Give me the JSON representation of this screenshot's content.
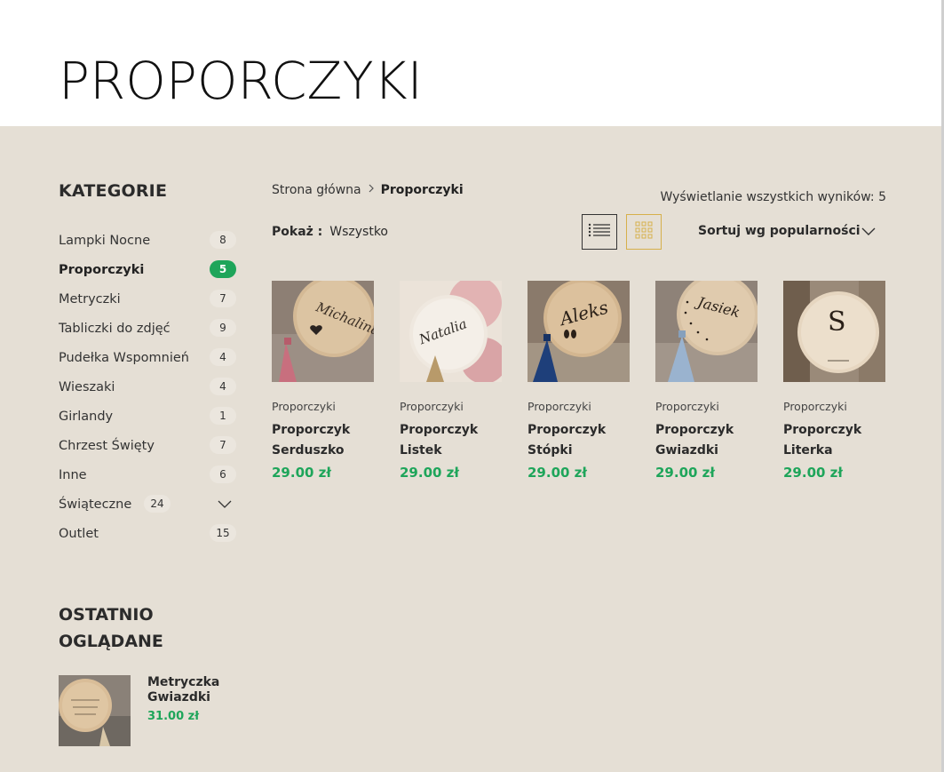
{
  "page": {
    "title": "PROPORCZYKI"
  },
  "sidebar": {
    "categories_title": "KATEGORIE",
    "categories": [
      {
        "label": "Lampki Nocne",
        "count": "8"
      },
      {
        "label": "Proporczyki",
        "count": "5",
        "active": true
      },
      {
        "label": "Metryczki",
        "count": "7"
      },
      {
        "label": "Tabliczki do zdjęć",
        "count": "9"
      },
      {
        "label": "Pudełka Wspomnień",
        "count": "4"
      },
      {
        "label": "Wieszaki",
        "count": "4"
      },
      {
        "label": "Girlandy",
        "count": "1"
      },
      {
        "label": "Chrzest Święty",
        "count": "7"
      },
      {
        "label": "Inne",
        "count": "6"
      },
      {
        "label": "Świąteczne",
        "count": "24",
        "expandable": true
      },
      {
        "label": "Outlet",
        "count": "15"
      }
    ],
    "recent_title": "OSTATNIO OGLĄDANE",
    "recent": [
      {
        "name": "Metryczka Gwiazdki",
        "price": "31.00 zł"
      }
    ]
  },
  "main": {
    "breadcrumb": {
      "home": "Strona główna",
      "current": "Proporczyki"
    },
    "result_count": "Wyświetlanie wszystkich wyników: 5",
    "show": {
      "label": "Pokaż :",
      "value": "Wszystko"
    },
    "sort": {
      "label": "Sortuj wg popularności"
    },
    "view_icons": {
      "list": "list-view-icon",
      "grid": "grid-view-icon"
    },
    "products": [
      {
        "category": "Proporczyki",
        "name_line1": "Proporczyk",
        "name_line2": "Serduszko",
        "price": "29.00 zł",
        "image_text": "Michalina",
        "tassel": "#c86f7e"
      },
      {
        "category": "Proporczyki",
        "name_line1": "Proporczyk",
        "name_line2": "Listek",
        "price": "29.00 zł",
        "image_text": "Natalia",
        "tassel": "#b89a6a"
      },
      {
        "category": "Proporczyki",
        "name_line1": "Proporczyk",
        "name_line2": "Stópki",
        "price": "29.00 zł",
        "image_text": "Aleks",
        "tassel": "#1e3f7a"
      },
      {
        "category": "Proporczyki",
        "name_line1": "Proporczyk",
        "name_line2": "Gwiazdki",
        "price": "29.00 zł",
        "image_text": "Jasiek",
        "tassel": "#9ab3cf"
      },
      {
        "category": "Proporczyki",
        "name_line1": "Proporczyk",
        "name_line2": "Literka",
        "price": "29.00 zł",
        "image_text": "S",
        "tassel": "#b89a6a"
      }
    ]
  },
  "colors": {
    "accent_green": "#1ea55a",
    "grid_icon_gold": "#d6b04b",
    "background": "#e5dfd5"
  }
}
